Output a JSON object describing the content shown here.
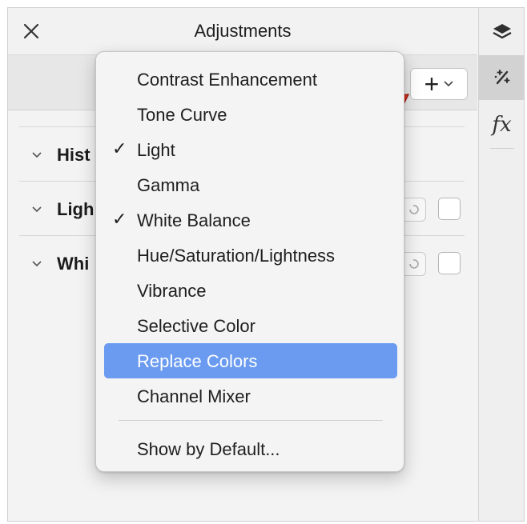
{
  "panel": {
    "title": "Adjustments"
  },
  "toolbar": {
    "add_symbol": "+"
  },
  "layers": [
    {
      "label": "Hist"
    },
    {
      "label": "Ligh"
    },
    {
      "label": "Whi"
    }
  ],
  "menu": {
    "items": [
      {
        "label": "Contrast Enhancement",
        "checked": false
      },
      {
        "label": "Tone Curve",
        "checked": false
      },
      {
        "label": "Light",
        "checked": true,
        "check": "✓"
      },
      {
        "label": "Gamma",
        "checked": false
      },
      {
        "label": "White Balance",
        "checked": true,
        "check": "✓"
      },
      {
        "label": "Hue/Saturation/Lightness",
        "checked": false
      },
      {
        "label": "Vibrance",
        "checked": false
      },
      {
        "label": "Selective Color",
        "checked": false
      },
      {
        "label": "Replace Colors",
        "checked": false,
        "highlighted": true
      },
      {
        "label": "Channel Mixer",
        "checked": false
      }
    ],
    "footer_item": "Show by Default..."
  },
  "sidebar": {
    "fx_label": "fx"
  },
  "icons": {
    "close": "close-icon",
    "chevron": "chevron-down-icon",
    "layers": "layers-icon",
    "adjust": "adjustments-icon",
    "fx": "fx-icon",
    "reset": "reset-icon"
  },
  "colors": {
    "highlight": "#6a9bf0",
    "arrow": "#e0321c"
  }
}
